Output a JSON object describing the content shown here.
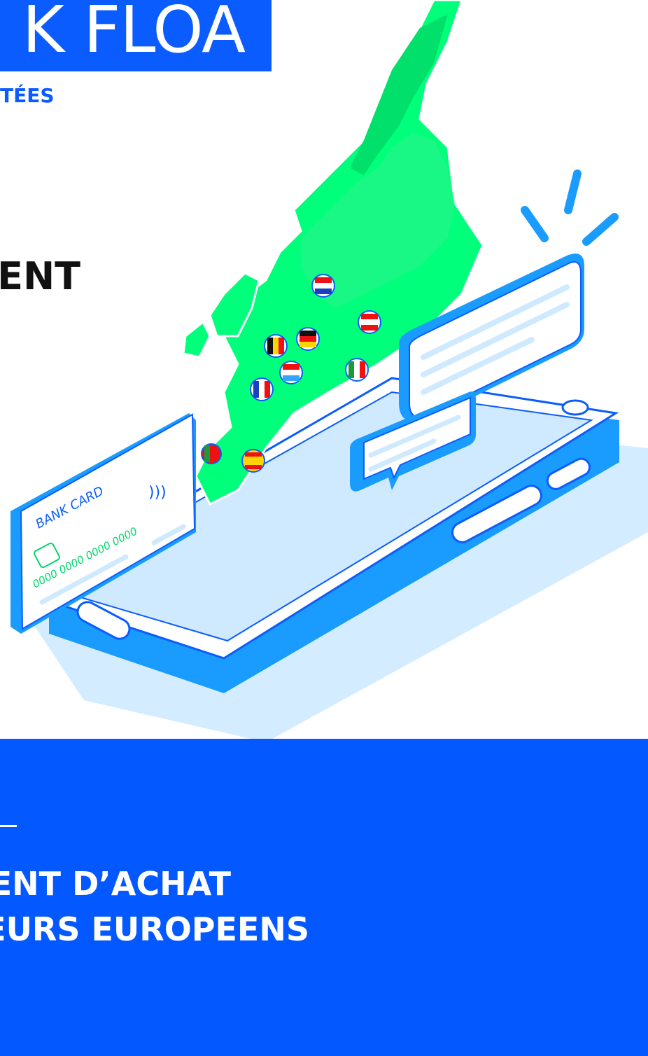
{
  "header": {
    "title": "K FLOA",
    "subtitle": "TÉES",
    "headline": "ENT"
  },
  "illustration": {
    "card_label": "BANK CARD",
    "card_numbers": [
      "0000",
      "0000",
      "0000",
      "0000"
    ],
    "colors": {
      "map_green": "#00ff7a",
      "accent_blue": "#0b5cff",
      "phone_blue": "#1a9cff",
      "light_blue": "#cfeaff"
    },
    "flags": [
      "netherlands-flag",
      "austria-flag",
      "belgium-flag",
      "germany-flag",
      "luxembourg-flag",
      "italy-flag",
      "france-flag",
      "portugal-flag",
      "spain-flag"
    ]
  },
  "band": {
    "dash": "–",
    "line1": "ENT D’ACHAT",
    "line2": "EURS EUROPEENS",
    "background": "#0359ff"
  }
}
